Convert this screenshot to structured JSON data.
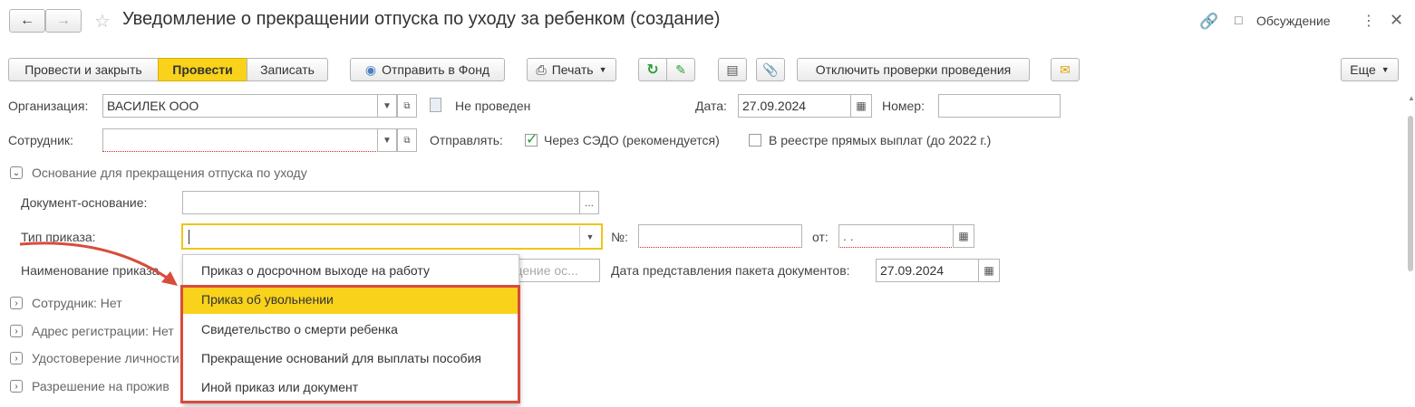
{
  "window": {
    "title": "Уведомление о прекращении отпуска по уходу за ребенком (создание)",
    "discussion_label": "Обсуждение"
  },
  "toolbar": {
    "post_close": "Провести и закрыть",
    "post": "Провести",
    "save": "Записать",
    "send_fund": "Отправить в Фонд",
    "print": "Печать",
    "disable_checks": "Отключить проверки проведения",
    "more": "Еще"
  },
  "form": {
    "org_label": "Организация:",
    "org_value": "ВАСИЛЕК ООО",
    "status": "Не проведен",
    "date_label": "Дата:",
    "date_value": "27.09.2024",
    "number_label": "Номер:",
    "employee_label": "Сотрудник:",
    "send_label": "Отправлять:",
    "via_sedo": "Через СЭДО (рекомендуется)",
    "in_registry": "В реестре прямых выплат (до 2022 г.)",
    "group_basis": "Основание для прекращения отпуска по уходу",
    "doc_basis_label": "Документ-основание:",
    "order_type_label": "Тип приказа:",
    "no_label": "№:",
    "from_label": "от:",
    "from_value": " .  .",
    "order_name_label": "Наименование приказа",
    "order_name_placeholder": "щение ос...",
    "package_date_label": "Дата представления пакета документов:",
    "package_date_value": "27.09.2024",
    "group_employee": "Сотрудник: Нет",
    "group_address": "Адрес регистрации: Нет",
    "group_id": "Удостоверение личности",
    "group_permit": "Разрешение на прожив"
  },
  "dropdown": {
    "items": [
      "Приказ о досрочном выходе на работу",
      "Приказ об увольнении",
      "Свидетельство о смерти ребенка",
      "Прекращение оснований для выплаты пособия",
      "Иной приказ или документ"
    ],
    "selected_index": 1
  },
  "colors": {
    "accent_yellow": "#f9d21b",
    "annotation_red": "#d94b3c"
  }
}
